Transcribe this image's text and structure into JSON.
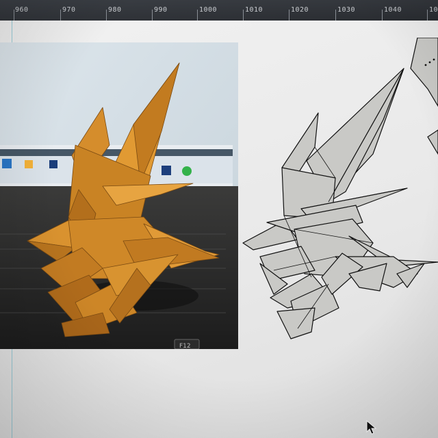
{
  "ruler": {
    "ticks": [
      "960",
      "970",
      "980",
      "990",
      "1000",
      "1010",
      "1020",
      "1030",
      "1040",
      "10"
    ]
  },
  "photo_screen": {
    "visible_keys": [
      "F12"
    ]
  },
  "colors": {
    "paper": "#d18a2a",
    "cad_fill": "#c9c9c6",
    "ruler_bg": "#2d3035",
    "guide": "#86c7d6"
  }
}
